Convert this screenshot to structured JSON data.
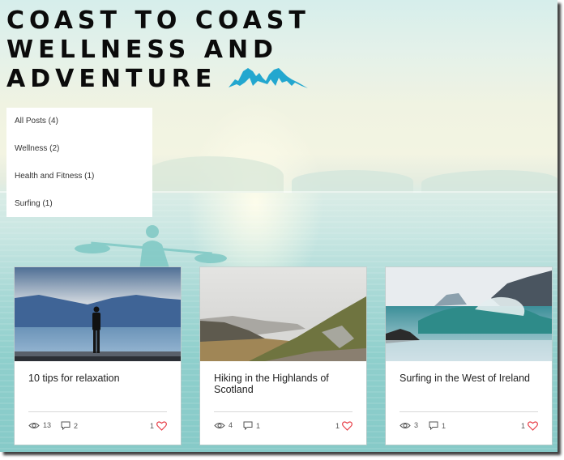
{
  "header": {
    "title_lines": [
      "COAST TO COAST",
      "WELLNESS AND",
      "ADVENTURE"
    ],
    "logo_icon": "mountains-icon",
    "logo_color": "#22a7cf"
  },
  "categories": [
    {
      "label": "All Posts (4)"
    },
    {
      "label": "Wellness (2)"
    },
    {
      "label": "Health and Fitness (1)"
    },
    {
      "label": "Surfing (1)"
    }
  ],
  "posts": [
    {
      "title": "10 tips for relaxation",
      "image": "man-standing-by-lake-photo",
      "views": "13",
      "comments": "2",
      "likes": "1"
    },
    {
      "title": "Hiking in the Highlands of Scotland",
      "image": "highland-mountain-trail-photo",
      "views": "4",
      "comments": "1",
      "likes": "1"
    },
    {
      "title": "Surfing in the West of Ireland",
      "image": "crashing-wave-photo",
      "views": "3",
      "comments": "1",
      "likes": "1"
    }
  ],
  "colors": {
    "like_heart": "#e8414a",
    "title_text": "#0b0b0b"
  }
}
